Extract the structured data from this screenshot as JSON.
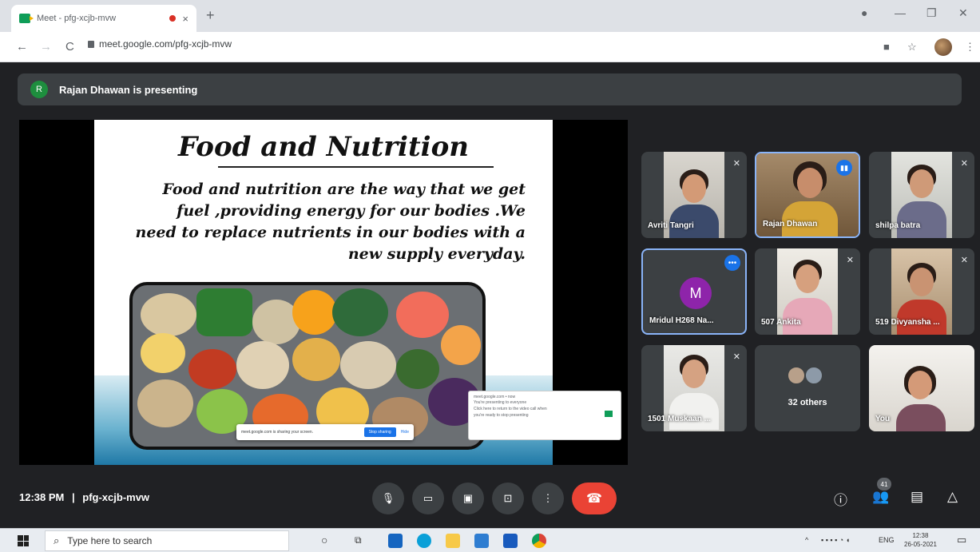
{
  "browser": {
    "tab_title": "Meet - pfg-xcjb-mvw",
    "tab_close": "×",
    "new_tab": "+",
    "url": "meet.google.com/pfg-xcjb-mvw",
    "back": "←",
    "forward": "→",
    "reload": "C",
    "win_minimize": "—",
    "win_restore": "❐",
    "win_close": "✕",
    "star": "☆",
    "menu": "⋮"
  },
  "presenting": {
    "avatar_letter": "R",
    "text": "Rajan Dhawan is presenting"
  },
  "slide": {
    "title": "Food and Nutrition",
    "body_lines": [
      "Food and nutrition are the way that we get",
      "fuel ,providing energy for our bodies .We",
      "need to replace nutrients in our bodies with a",
      "new supply everyday."
    ],
    "share_bar_text": "meet.google.com is sharing your screen.",
    "share_stop": "Stop sharing",
    "share_hide": "Hide",
    "notification_title": "meet.google.com • now",
    "notification_lines": [
      "You're presenting to everyone",
      "Click here to return to the video call when",
      "you're ready to stop presenting"
    ]
  },
  "participants": [
    {
      "name": "Avriti Tangri",
      "state": "muted"
    },
    {
      "name": "Rajan Dhawan",
      "state": "speaking"
    },
    {
      "name": "shilpa batra",
      "state": "muted"
    },
    {
      "name": "Mridul H268 Na...",
      "state": "more",
      "avatar_letter": "M",
      "avatar_color": "#8e24aa"
    },
    {
      "name": "507 Ankita",
      "state": "muted"
    },
    {
      "name": "519 Divyansha ...",
      "state": "muted"
    },
    {
      "name": "1501 Muskaan ...",
      "state": "muted"
    },
    {
      "name": "32 others",
      "state": "group"
    },
    {
      "name": "You",
      "state": "self"
    }
  ],
  "bottom": {
    "time": "12:38 PM",
    "separator": "|",
    "meeting_code": "pfg-xcjb-mvw",
    "people_count": "41"
  },
  "taskbar": {
    "search_placeholder": "Type here to search",
    "language": "ENG",
    "time": "12:38",
    "date": "26-05-2021"
  },
  "colors": {
    "meet_bg": "#202124",
    "tile_bg": "#3c4043",
    "hangup": "#ea4335",
    "accent": "#1a73e8"
  }
}
